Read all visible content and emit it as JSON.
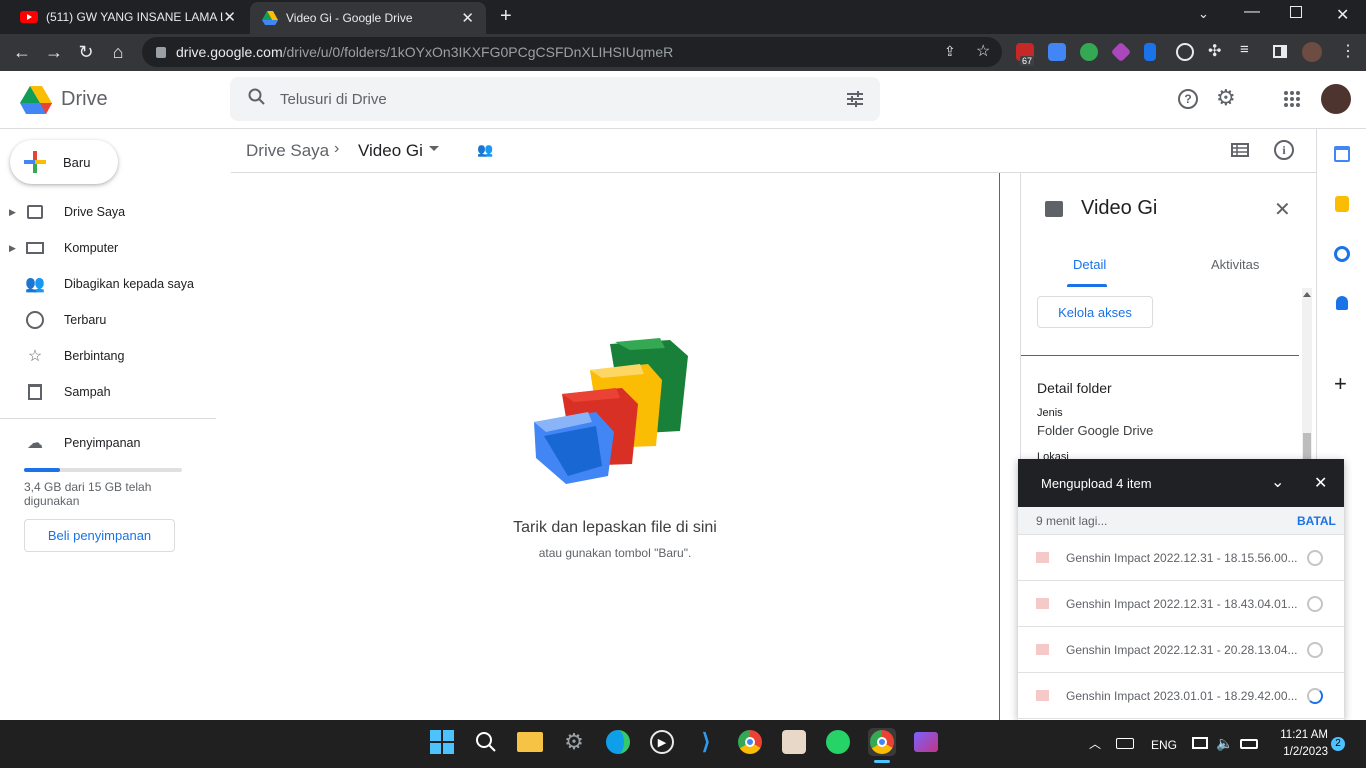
{
  "browser": {
    "tabs": [
      {
        "title": "(511) GW YANG INSANE LAMA L",
        "icon": "youtube-icon"
      },
      {
        "title": "Video Gi - Google Drive",
        "icon": "google-drive-icon"
      }
    ],
    "url_host": "drive.google.com",
    "url_path": "/drive/u/0/folders/1kOYxOn3IKXFG0PCgCSFDnXLIHSIUqmeR",
    "ext_badge": "67"
  },
  "drive": {
    "logo": "Drive",
    "search_placeholder": "Telusuri di Drive",
    "new_label": "Baru",
    "nav": [
      {
        "label": "Drive Saya",
        "icon": "my-drive-icon"
      },
      {
        "label": "Komputer",
        "icon": "computer-icon"
      },
      {
        "label": "Dibagikan kepada saya",
        "icon": "shared-icon"
      },
      {
        "label": "Terbaru",
        "icon": "clock-icon"
      },
      {
        "label": "Berbintang",
        "icon": "star-icon"
      },
      {
        "label": "Sampah",
        "icon": "trash-icon"
      }
    ],
    "storage": {
      "label": "Penyimpanan",
      "text": "3,4 GB dari 15 GB telah digunakan",
      "used_fraction": 0.227,
      "buy_label": "Beli penyimpanan"
    },
    "breadcrumb": {
      "root": "Drive Saya",
      "current": "Video Gi"
    },
    "empty": {
      "title": "Tarik dan lepaskan file di sini",
      "subtitle": "atau gunakan tombol \"Baru\"."
    }
  },
  "details": {
    "title": "Video Gi",
    "tabs": [
      "Detail",
      "Aktivitas"
    ],
    "manage_label": "Kelola akses",
    "section": "Detail folder",
    "type_label": "Jenis",
    "type_value": "Folder Google Drive",
    "truncated": "Lokasi"
  },
  "upload": {
    "title": "Mengupload 4 item",
    "remaining": "9 menit lagi...",
    "cancel": "BATAL",
    "items": [
      "Genshin Impact 2022.12.31 - 18.15.56.00...",
      "Genshin Impact 2022.12.31 - 18.43.04.01...",
      "Genshin Impact 2022.12.31 - 20.28.13.04...",
      "Genshin Impact 2023.01.01 - 18.29.42.00..."
    ]
  },
  "taskbar": {
    "lang": "ENG",
    "time": "11:21 AM",
    "date": "1/2/2023",
    "notif": "2"
  },
  "colors": {
    "accent": "#1a73e8",
    "chrome_dark": "#202124",
    "chrome_toolbar": "#35363a",
    "upload_header": "#202124"
  }
}
